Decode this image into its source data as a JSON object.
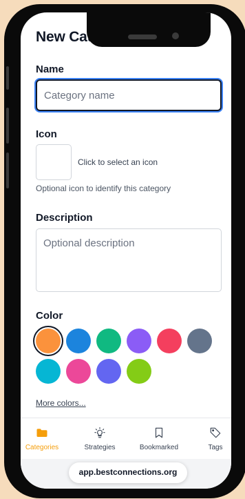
{
  "form": {
    "title": "New Category",
    "name_label": "Name",
    "name_placeholder": "Category name",
    "name_value": "",
    "icon_label": "Icon",
    "icon_hint": "Click to select an icon",
    "icon_help": "Optional icon to identify this category",
    "description_label": "Description",
    "description_placeholder": "Optional description",
    "description_value": "",
    "color_label": "Color",
    "selected_color": "#fb923c",
    "colors": [
      "#fb923c",
      "#1c84dd",
      "#10b981",
      "#8b5cf6",
      "#f43f5e",
      "#64748b",
      "#06b6d4",
      "#ec4899",
      "#6366f1",
      "#84cc16"
    ],
    "more_colors": "More colors..."
  },
  "tabs": [
    {
      "label": "Categories",
      "icon": "folder-icon",
      "active": true
    },
    {
      "label": "Strategies",
      "icon": "lightbulb-icon",
      "active": false
    },
    {
      "label": "Bookmarked",
      "icon": "bookmark-icon",
      "active": false
    },
    {
      "label": "Tags",
      "icon": "tag-icon",
      "active": false
    }
  ],
  "browser": {
    "url": "app.bestconnections.org"
  },
  "theme": {
    "accent": "#f59e0b",
    "focus": "#3b82f6"
  }
}
